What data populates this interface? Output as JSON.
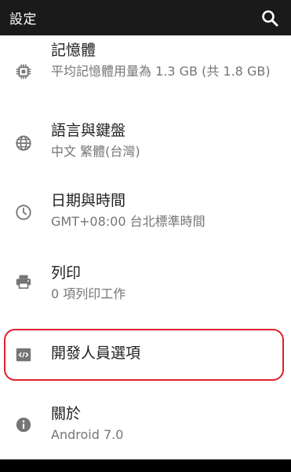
{
  "appbar": {
    "title": "設定",
    "search_icon": "search-icon"
  },
  "items": [
    {
      "title": "記憶體",
      "summary": "平均記憶體用量為 1.3 GB (共 1.8 GB)",
      "icon": "memory-icon"
    },
    {
      "title": "語言與鍵盤",
      "summary": "中文 繁體(台灣)",
      "icon": "globe-icon"
    },
    {
      "title": "日期與時間",
      "summary": "GMT+08:00 台北標準時間",
      "icon": "clock-icon"
    },
    {
      "title": "列印",
      "summary": "0 項列印工作",
      "icon": "printer-icon"
    },
    {
      "title": "開發人員選項",
      "icon": "developer-code-icon"
    },
    {
      "title": "關於",
      "summary": "Android 7.0",
      "icon": "info-icon"
    }
  ],
  "colors": {
    "appbar": "#1a1a1a",
    "icon": "#757575",
    "highlight": "#e0202b"
  }
}
